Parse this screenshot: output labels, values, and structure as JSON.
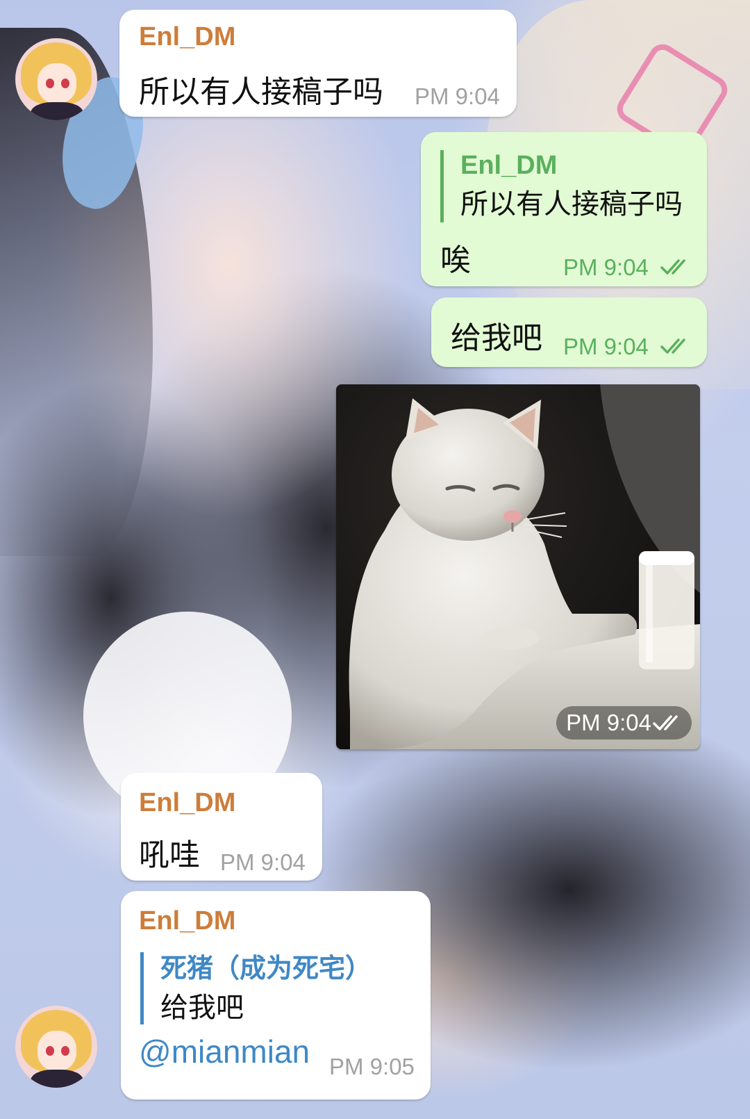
{
  "theme": {
    "sender_color": "#cd7d3a",
    "reply_color": "#3f88c6",
    "outgoing_bubble": "#e2fbd4",
    "incoming_bubble": "#ffffff",
    "outgoing_time_color": "#5ab05d"
  },
  "messages": [
    {
      "direction": "incoming",
      "sender": "Enl_DM",
      "text": "所以有人接稿子吗",
      "time": "PM 9:04"
    },
    {
      "direction": "outgoing",
      "reply": {
        "name": "Enl_DM",
        "text": "所以有人接稿子吗"
      },
      "text": "唉",
      "time": "PM 9:04",
      "status_icon": "double-check-icon"
    },
    {
      "direction": "outgoing",
      "text": "给我吧",
      "time": "PM 9:04",
      "status_icon": "double-check-icon"
    },
    {
      "direction": "outgoing",
      "media": "cat-photo",
      "time": "PM 9:04",
      "status_icon": "double-check-icon"
    },
    {
      "direction": "incoming",
      "sender": "Enl_DM",
      "text": "吼哇",
      "time": "PM 9:04"
    },
    {
      "direction": "incoming",
      "sender": "Enl_DM",
      "reply": {
        "name": "死猪（成为死宅）",
        "text": "给我吧"
      },
      "mention": "@mianmian",
      "time": "PM 9:05"
    }
  ]
}
